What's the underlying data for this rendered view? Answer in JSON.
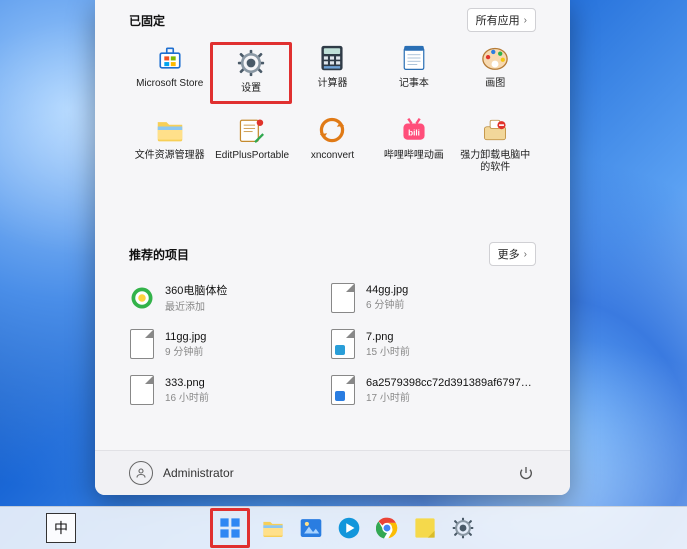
{
  "start": {
    "pinned_title": "已固定",
    "all_apps_label": "所有应用",
    "apps": [
      {
        "name": "Microsoft Store",
        "icon": "ms-store-icon",
        "highlight": false
      },
      {
        "name": "设置",
        "icon": "settings-icon",
        "highlight": true
      },
      {
        "name": "计算器",
        "icon": "calculator-icon",
        "highlight": false
      },
      {
        "name": "记事本",
        "icon": "notepad-icon",
        "highlight": false
      },
      {
        "name": "画图",
        "icon": "paint-icon",
        "highlight": false
      },
      {
        "name": "文件资源管理器",
        "icon": "explorer-icon",
        "highlight": false
      },
      {
        "name": "EditPlusPortable",
        "icon": "editplus-icon",
        "highlight": false
      },
      {
        "name": "xnconvert",
        "icon": "xnconvert-icon",
        "highlight": false
      },
      {
        "name": "哔哩哔哩动画",
        "icon": "bilibili-icon",
        "highlight": false
      },
      {
        "name": "强力卸载电脑中的软件",
        "icon": "uninstall-icon",
        "highlight": false
      }
    ],
    "recommended_title": "推荐的项目",
    "more_label": "更多",
    "recommended": [
      {
        "name": "360电脑体检",
        "sub": "最近添加",
        "thumb": "360-icon"
      },
      {
        "name": "44gg.jpg",
        "sub": "6 分钟前",
        "thumb": "file-icon"
      },
      {
        "name": "11gg.jpg",
        "sub": "9 分钟前",
        "thumb": "file-icon"
      },
      {
        "name": "7.png",
        "sub": "15 小时前",
        "thumb": "file-png-icon"
      },
      {
        "name": "333.png",
        "sub": "16 小时前",
        "thumb": "file-icon"
      },
      {
        "name": "6a2579398cc72d391389af679703f3...",
        "sub": "17 小时前",
        "thumb": "file-img-icon"
      }
    ],
    "user_name": "Administrator"
  },
  "taskbar": {
    "ime_label": "中",
    "items": [
      {
        "name": "start-button",
        "icon": "win11-logo-icon",
        "color": "#2f87f3",
        "highlight": true
      },
      {
        "name": "explorer-button",
        "icon": "explorer-icon",
        "color": "#f4c24a",
        "highlight": false
      },
      {
        "name": "photos-button",
        "icon": "photos-icon",
        "color": "#2a7de1",
        "highlight": false
      },
      {
        "name": "player-button",
        "icon": "play-icon",
        "color": "#1296db",
        "highlight": false
      },
      {
        "name": "chrome-button",
        "icon": "chrome-icon",
        "color": "#34a853",
        "highlight": false
      },
      {
        "name": "sticky-button",
        "icon": "note-icon",
        "color": "#f5d94b",
        "highlight": false
      },
      {
        "name": "settings-button",
        "icon": "settings-icon",
        "color": "#51606e",
        "highlight": false
      }
    ]
  }
}
